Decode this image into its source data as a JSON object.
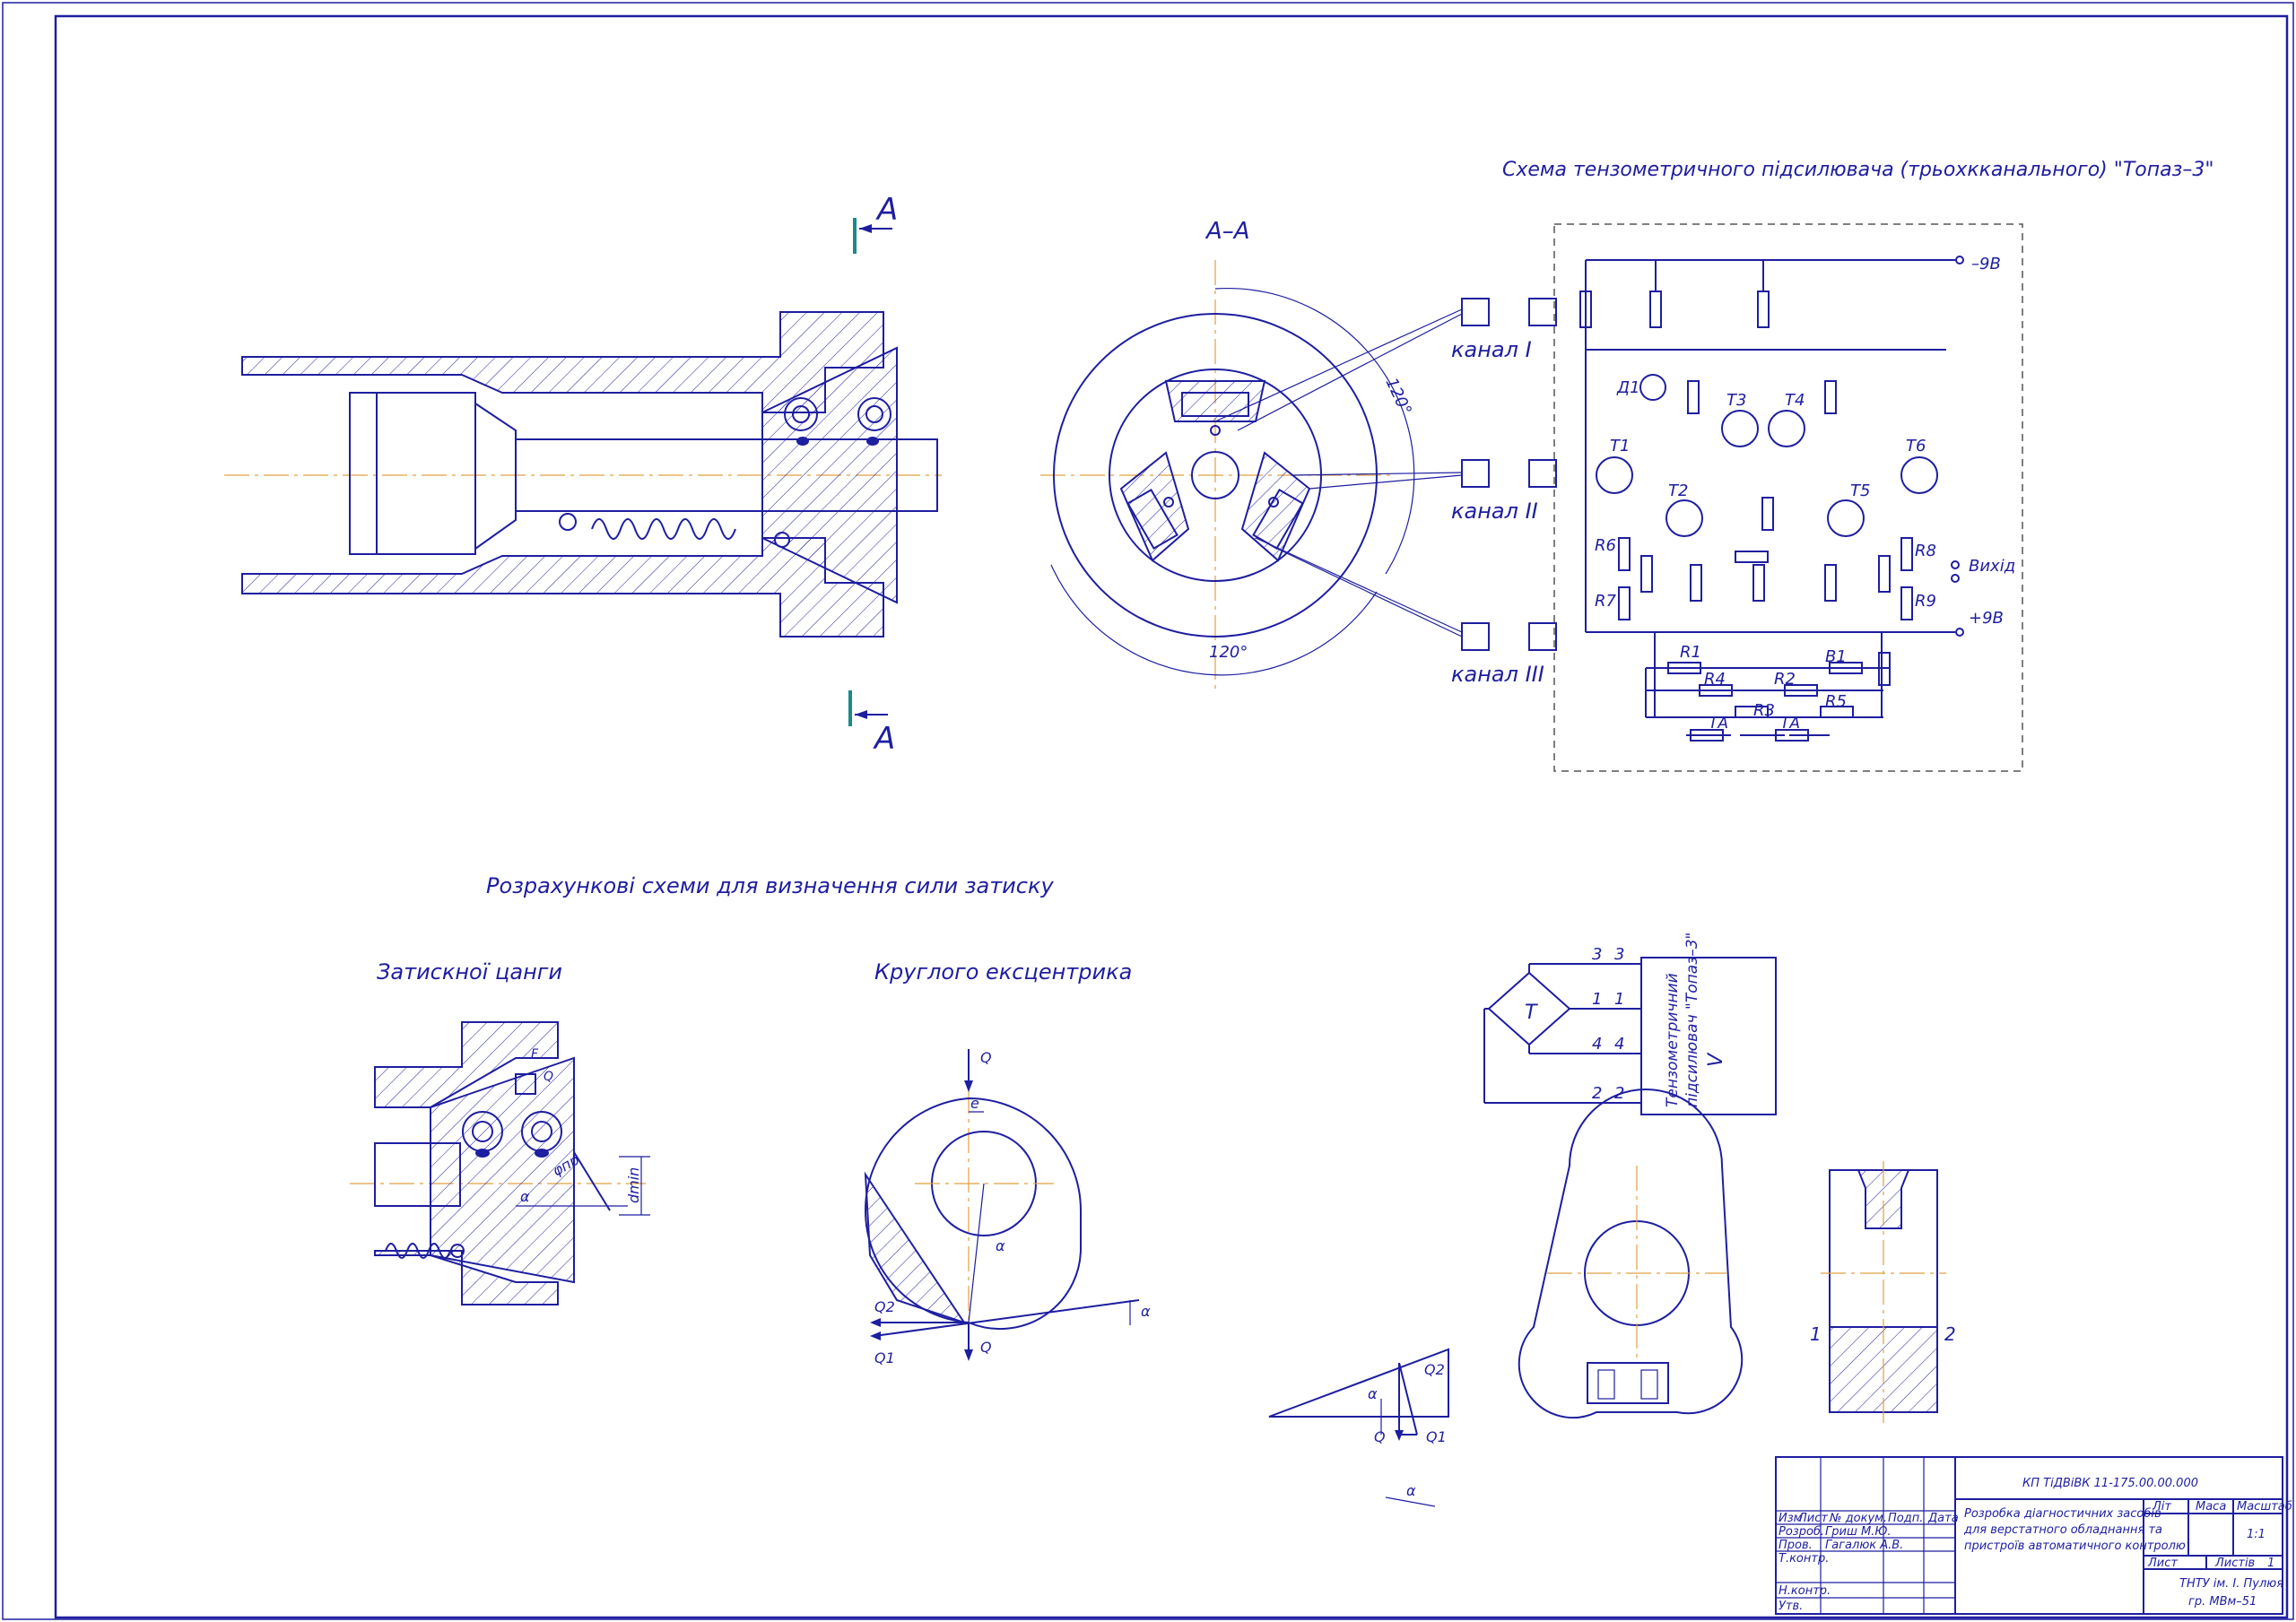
{
  "colors": {
    "line": "#1e1ea0",
    "axis": "#e0a040",
    "frame": "#1e1ea0",
    "section_mark": "#1a8a8a"
  },
  "section": {
    "mark_top": "А",
    "mark_bottom": "А",
    "view_title": "А–А",
    "angle_top": "120°",
    "angle_bottom": "120°"
  },
  "channels": [
    "канал I",
    "канал II",
    "канал III"
  ],
  "amplifier": {
    "title": "Схема тензометричного підсилювача (трьохкканального) \"Топаз–3\"",
    "supply_neg": "–9В",
    "supply_pos": "+9В",
    "output": "Вихід",
    "diode": "Д1",
    "transistors": [
      "Т1",
      "Т2",
      "Т3",
      "Т4",
      "Т5",
      "Т6"
    ],
    "resistors": [
      "R1",
      "R2",
      "R3",
      "R4",
      "R5",
      "R6",
      "R7",
      "R8",
      "R9"
    ],
    "switch": "В1",
    "sensors": [
      "ТА",
      "ТА"
    ]
  },
  "calc": {
    "heading": "Розрахункові схеми для визначення сили затиску",
    "collet_title": "Затискної цанги",
    "eccentric_title": "Круглого ексцентрика",
    "collet_labels": {
      "diameter": "dmin",
      "angle": "φпр",
      "alpha": "α",
      "force": "F",
      "q": "Q"
    },
    "eccentric_labels": {
      "q_top": "Q",
      "e": "e",
      "alpha": "α",
      "q2": "Q2",
      "q1": "Q1",
      "q_bottom": "Q",
      "a_right": "α"
    },
    "triangle_labels": {
      "alpha": "α",
      "q2": "Q2",
      "q": "Q",
      "q1": "Q1",
      "a": "α"
    }
  },
  "bridge": {
    "sensor": "T",
    "pins_left": [
      "3",
      "1",
      "4",
      "2"
    ],
    "pins_right": [
      "3",
      "1",
      "4",
      "2"
    ],
    "device_line1": "Тензометричний",
    "device_line2": "підсилювач \"Топаз–3\"",
    "device_v": "V"
  },
  "side_view": {
    "mark1": "1",
    "mark2": "2"
  },
  "title_block": {
    "doc_code": "КП ТіДВіВК 11-175.00.00.000",
    "description": [
      "Розробка діагностичних засобів",
      "для верстатного обладнання та",
      "пристроїв автоматичного контролю"
    ],
    "col_lit": "Літ",
    "col_mass": "Маса",
    "col_scale": "Масштаб",
    "scale": "1:1",
    "sheet_label": "Лист",
    "sheets_label": "Листів",
    "sheets_count": "1",
    "org_line1": "ТНТУ ім. І. Пулюя",
    "org_line2": "гр. МВм–51",
    "headers": [
      "Изм",
      "Лист",
      "№ докум.",
      "Подп.",
      "Дата"
    ],
    "roles": [
      {
        "role": "Розроб.",
        "name": "Гриш М.Ю."
      },
      {
        "role": "Пров.",
        "name": "Гагалюк А.В."
      },
      {
        "role": "Т.контр.",
        "name": ""
      },
      {
        "role": "Н.контр.",
        "name": ""
      },
      {
        "role": "Утв.",
        "name": ""
      }
    ]
  }
}
